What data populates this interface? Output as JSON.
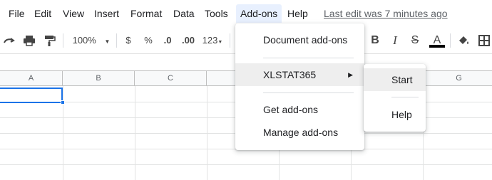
{
  "menubar": {
    "items": [
      "File",
      "Edit",
      "View",
      "Insert",
      "Format",
      "Data",
      "Tools",
      "Add-ons",
      "Help"
    ],
    "active": "Add-ons",
    "last_edit": "Last edit was 7 minutes ago"
  },
  "toolbar": {
    "zoom": "100%",
    "currency": "$",
    "percent": "%",
    "decrease_decimals": ".0",
    "increase_decimals": ".00",
    "more_formats": "123",
    "bold": "B",
    "italic": "I",
    "strikethrough": "S",
    "text_color": "A",
    "icons": [
      "redo-icon",
      "print-icon",
      "paint-format-icon",
      "bold-icon",
      "italic-icon",
      "strikethrough-icon",
      "text-color-icon",
      "fill-color-icon",
      "borders-icon"
    ]
  },
  "grid": {
    "columns": [
      "A",
      "B",
      "C",
      "",
      "",
      "",
      "G"
    ]
  },
  "addons_menu": {
    "items": [
      "Document add-ons",
      "XLSTAT365",
      "Get add-ons",
      "Manage add-ons"
    ],
    "hovered": "XLSTAT365"
  },
  "xlstat_submenu": {
    "items": [
      "Start",
      "Help"
    ],
    "hovered": "Start"
  },
  "colors": {
    "accent": "#1a73e8",
    "active_menu_bg": "#e8f0fe",
    "hover_bg": "#eeeeee"
  }
}
